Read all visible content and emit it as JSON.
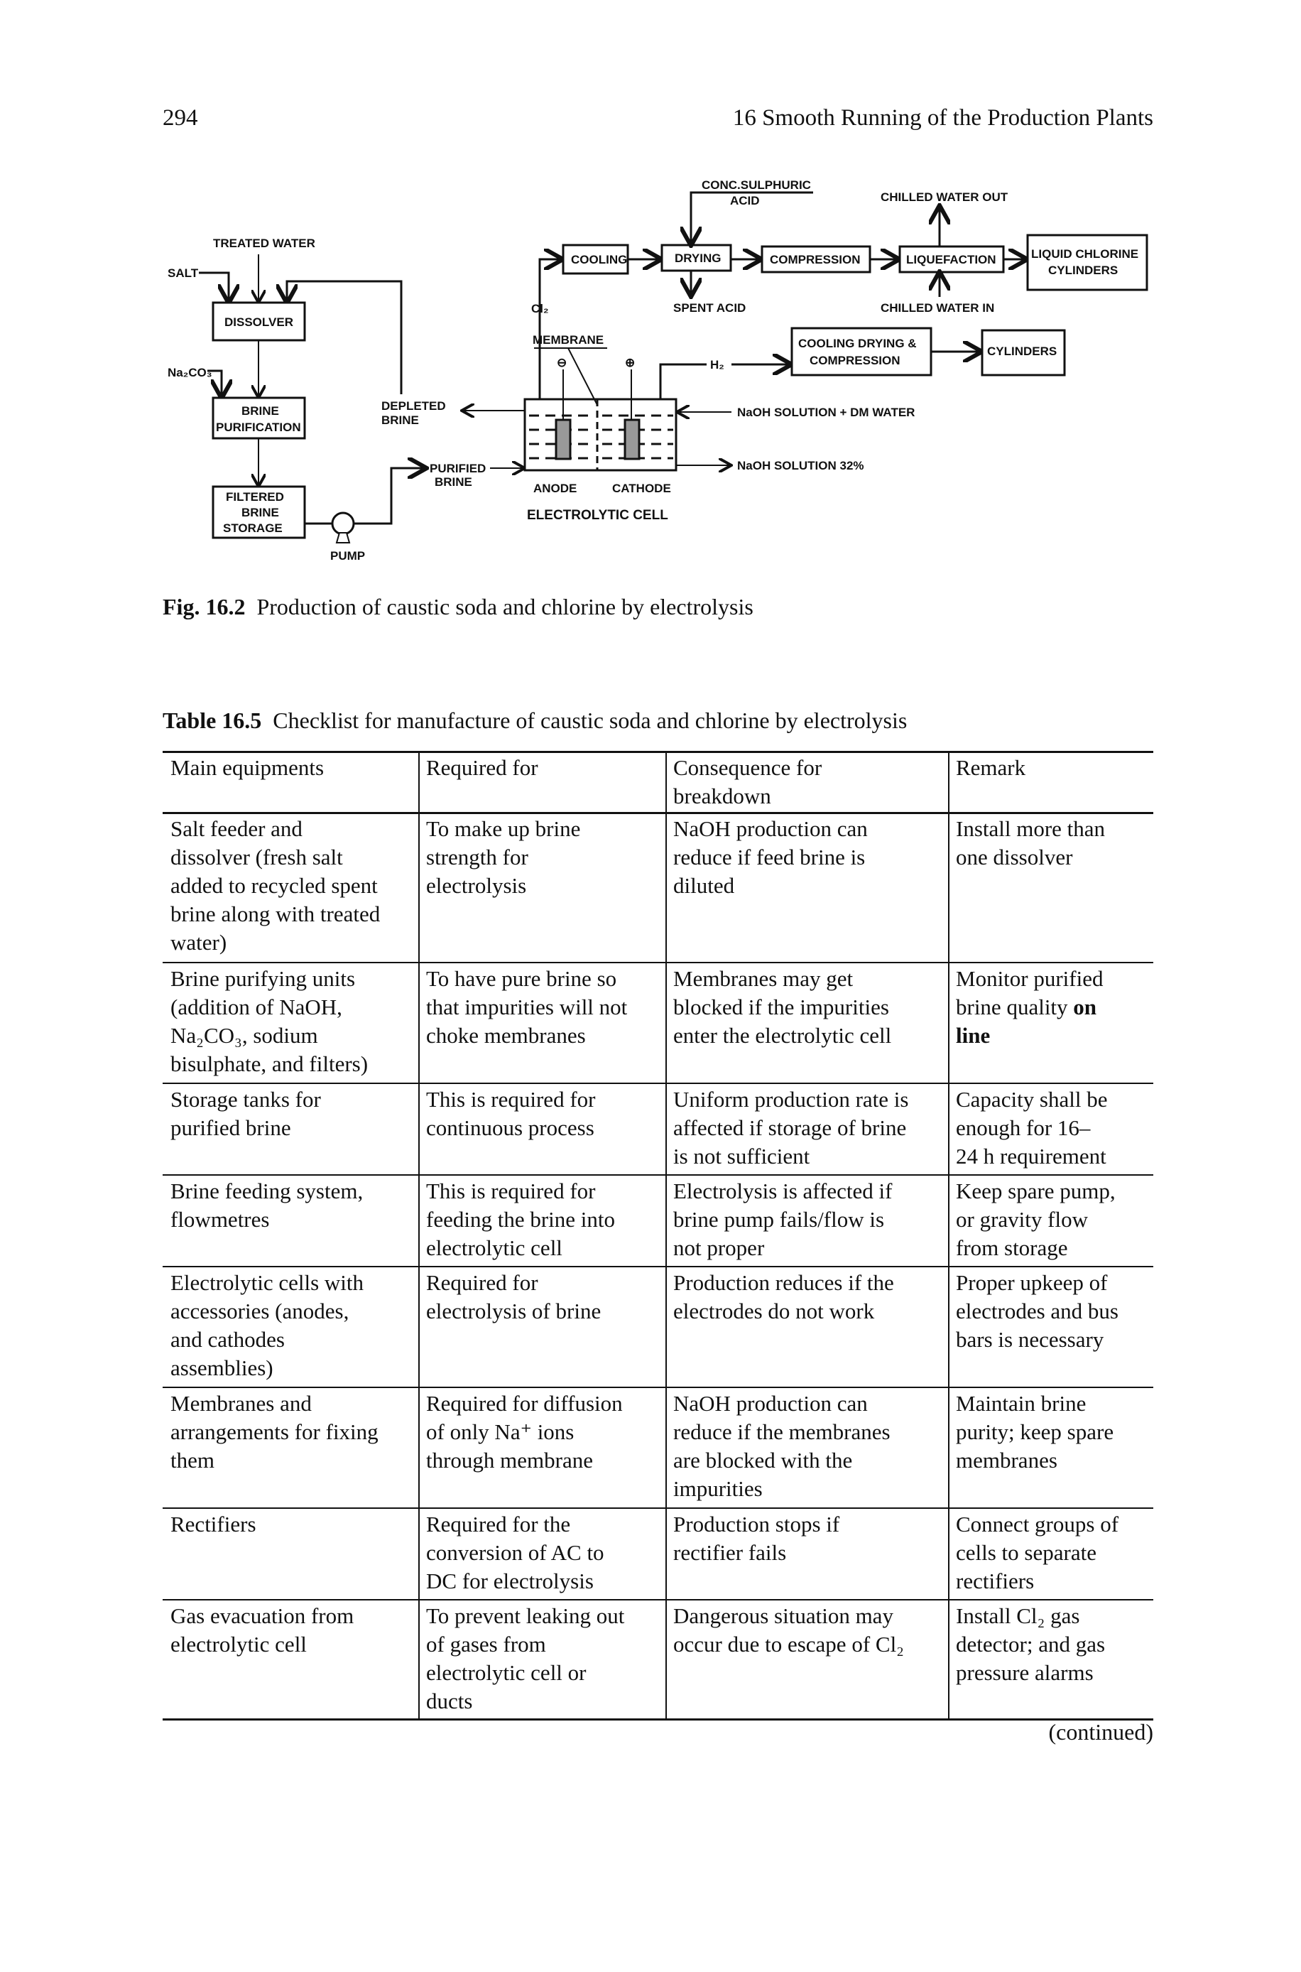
{
  "header": {
    "page_number": "294",
    "running_title": "16  Smooth Running of the Production Plants"
  },
  "figure": {
    "labels": {
      "treated_water": "TREATED WATER",
      "salt": "SALT",
      "na2co3": "Na₂CO₃",
      "dissolver": "DISSOLVER",
      "brine_purification_1": "BRINE",
      "brine_purification_2": "PURIFICATION",
      "filtered_1": "FILTERED",
      "filtered_2": "BRINE",
      "filtered_3": "STORAGE",
      "pump": "PUMP",
      "depleted_1": "DEPLETED",
      "depleted_2": "BRINE",
      "purified_1": "PURIFIED",
      "purified_2": "BRINE",
      "cl2": "Cl₂",
      "membrane": "MEMBRANE",
      "h2": "H₂",
      "anode": "ANODE",
      "cathode": "CATHODE",
      "electrolytic_cell": "ELECTROLYTIC CELL",
      "cooling": "COOLING",
      "drying": "DRYING",
      "compression": "COMPRESSION",
      "liquefaction": "LIQUEFACTION",
      "liquid_chlorine_1": "LIQUID CHLORINE",
      "liquid_chlorine_2": "CYLINDERS",
      "conc_sulphuric": "CONC.SULPHURIC",
      "acid": "ACID",
      "spent_acid": "SPENT ACID",
      "chilled_out": "CHILLED WATER OUT",
      "chilled_in": "CHILLED WATER IN",
      "h2_process_1": "COOLING DRYING &",
      "h2_process_2": "COMPRESSION",
      "cylinders": "CYLINDERS",
      "naoh_dm": "NaOH SOLUTION + DM WATER",
      "naoh_32": "NaOH SOLUTION 32%",
      "anode_terminal": "⊖",
      "cathode_terminal": "⊕"
    },
    "caption_label": "Fig. 16.2",
    "caption_text": "  Production of caustic soda and chlorine by electrolysis"
  },
  "table": {
    "label": "Table 16.5",
    "title": "  Checklist for manufacture of caustic soda and chlorine by electrolysis",
    "headers": [
      [
        "Main equipments"
      ],
      [
        "Required for"
      ],
      [
        "Consequence for",
        "breakdown"
      ],
      [
        "Remark"
      ]
    ],
    "rows": [
      [
        [
          "Salt feeder and",
          "dissolver (fresh salt",
          "added to recycled spent",
          "brine along with treated",
          "water)"
        ],
        [
          "To make up brine",
          "strength for",
          "electrolysis"
        ],
        [
          "NaOH production can",
          "reduce if feed brine is",
          "diluted"
        ],
        [
          "Install more than",
          "one dissolver"
        ]
      ],
      [
        [
          "Brine purifying units",
          "(addition of NaOH,",
          "Na₂CO₃, sodium",
          "bisulphate, and filters)"
        ],
        [
          "To have pure brine so",
          "that impurities will not",
          "choke membranes"
        ],
        [
          "Membranes may get",
          "blocked if the impurities",
          "enter the electrolytic cell"
        ],
        [
          "Monitor purified",
          "brine quality ",
          "on",
          "line"
        ]
      ],
      [
        [
          "Storage tanks for",
          "purified brine"
        ],
        [
          "This is required for",
          "continuous process"
        ],
        [
          "Uniform production rate is",
          "affected if storage of brine",
          "is not sufficient"
        ],
        [
          "Capacity shall be",
          "enough for 16–",
          "24 h requirement"
        ]
      ],
      [
        [
          "Brine feeding system,",
          "flowmetres"
        ],
        [
          "This is required for",
          "feeding the brine into",
          "electrolytic cell"
        ],
        [
          "Electrolysis is affected if",
          "brine pump fails/flow is",
          "not proper"
        ],
        [
          "Keep spare pump,",
          "or gravity flow",
          "from storage"
        ]
      ],
      [
        [
          "Electrolytic cells with",
          "accessories (anodes,",
          "and cathodes",
          "assemblies)"
        ],
        [
          "Required for",
          "electrolysis of brine"
        ],
        [
          "Production reduces if the",
          "electrodes do not work"
        ],
        [
          "Proper upkeep of",
          "electrodes and bus",
          "bars is necessary"
        ]
      ],
      [
        [
          "Membranes and",
          "arrangements for fixing",
          "them"
        ],
        [
          "Required for diffusion",
          "of only Na⁺ ions",
          "through membrane"
        ],
        [
          "NaOH production can",
          "reduce if the membranes",
          "are blocked with the",
          "impurities"
        ],
        [
          "Maintain brine",
          "purity; keep spare",
          "membranes"
        ]
      ],
      [
        [
          "Rectifiers"
        ],
        [
          "Required for the",
          "conversion of AC to",
          "DC for electrolysis"
        ],
        [
          "Production stops if",
          "rectifier fails"
        ],
        [
          "Connect groups of",
          "cells to separate",
          "rectifiers"
        ]
      ],
      [
        [
          "Gas evacuation from",
          "electrolytic cell"
        ],
        [
          "To prevent leaking out",
          "of gases from",
          "electrolytic cell or",
          "ducts"
        ],
        [
          "Dangerous situation may",
          "occur due to escape of Cl₂"
        ],
        [
          "Install Cl₂ gas",
          "detector; and gas",
          "pressure alarms"
        ]
      ]
    ],
    "continued": "(continued)"
  }
}
